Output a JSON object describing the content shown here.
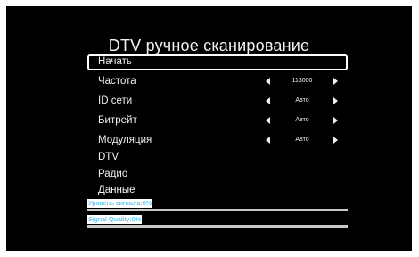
{
  "title": "DTV ручное сканирование",
  "menu": {
    "start": "Начать",
    "frequency": {
      "label": "Частота",
      "value": "113000"
    },
    "network_id": {
      "label": "ID сети",
      "value": "Авто"
    },
    "bitrate": {
      "label": "Битрейт",
      "value": "Авто"
    },
    "modulation": {
      "label": "Модуляция",
      "value": "Авто"
    },
    "dtv": "DTV",
    "radio": "Радио",
    "data": "Данные"
  },
  "status": {
    "signal_level": {
      "label": "Уровень сигнала:0%",
      "percent": 0
    },
    "signal_quality": {
      "label": "Signal Quality:0%",
      "percent": 0
    }
  },
  "colors": {
    "background": "#000000",
    "accent": "#2fb6e8",
    "text": "#f0f0f0",
    "bar_track": "#c8c8c8"
  }
}
